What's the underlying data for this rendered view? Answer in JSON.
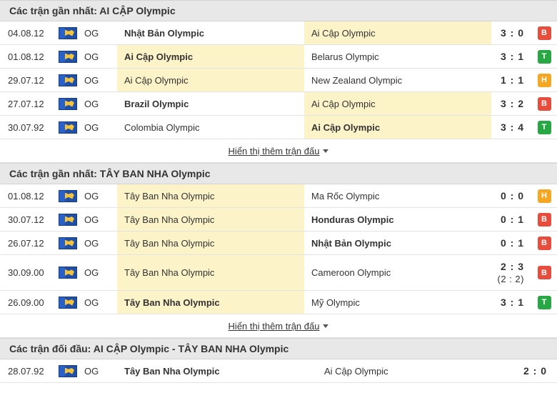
{
  "sections": [
    {
      "title": "Các trận gần nhất: AI CẬP Olympic",
      "more_label": "Hiển thị thêm trận đấu",
      "matches": [
        {
          "date": "04.08.12",
          "league": "OG",
          "home": "Nhật Bản Olympic",
          "away": "Ai Cập Olympic",
          "score": "3 : 0",
          "result": "B"
        },
        {
          "date": "01.08.12",
          "league": "OG",
          "home": "Ai Cập Olympic",
          "away": "Belarus Olympic",
          "score": "3 : 1",
          "result": "T"
        },
        {
          "date": "29.07.12",
          "league": "OG",
          "home": "Ai Cập Olympic",
          "away": "New Zealand Olympic",
          "score": "1 : 1",
          "result": "H"
        },
        {
          "date": "27.07.12",
          "league": "OG",
          "home": "Brazil Olympic",
          "away": "Ai Cập Olympic",
          "score": "3 : 2",
          "result": "B"
        },
        {
          "date": "30.07.92",
          "league": "OG",
          "home": "Colombia Olympic",
          "away": "Ai Cập Olympic",
          "score": "3 : 4",
          "result": "T"
        }
      ]
    },
    {
      "title": "Các trận gần nhất: TÂY BAN NHA Olympic",
      "more_label": "Hiển thị thêm trận đấu",
      "matches": [
        {
          "date": "01.08.12",
          "league": "OG",
          "home": "Tây Ban Nha Olympic",
          "away": "Ma Rốc Olympic",
          "score": "0 : 0",
          "result": "H"
        },
        {
          "date": "30.07.12",
          "league": "OG",
          "home": "Tây Ban Nha Olympic",
          "away": "Honduras Olympic",
          "score": "0 : 1",
          "result": "B"
        },
        {
          "date": "26.07.12",
          "league": "OG",
          "home": "Tây Ban Nha Olympic",
          "away": "Nhật Bản Olympic",
          "score": "0 : 1",
          "result": "B"
        },
        {
          "date": "30.09.00",
          "league": "OG",
          "home": "Tây Ban Nha Olympic",
          "away": "Cameroon Olympic",
          "score": "2 : 3",
          "penalty": "(2 : 2)",
          "result": "B"
        },
        {
          "date": "26.09.00",
          "league": "OG",
          "home": "Tây Ban Nha Olympic",
          "away": "Mỹ Olympic",
          "score": "3 : 1",
          "result": "T"
        }
      ]
    },
    {
      "title": "Các trận đối đầu: AI CẬP Olympic - TÂY BAN NHA Olympic",
      "matches": [
        {
          "date": "28.07.92",
          "league": "OG",
          "home": "Tây Ban Nha Olympic",
          "away": "Ai Cập Olympic",
          "score": "2 : 0"
        }
      ]
    }
  ],
  "colors": {
    "loss": "#e74c3c",
    "win": "#27a844",
    "draw": "#f5a623",
    "highlight": "#fdf3c8",
    "header_bg": "#e8e8e8"
  },
  "icons": {
    "league_flag": "olympic-flag-icon",
    "expand": "caret-down-icon"
  }
}
